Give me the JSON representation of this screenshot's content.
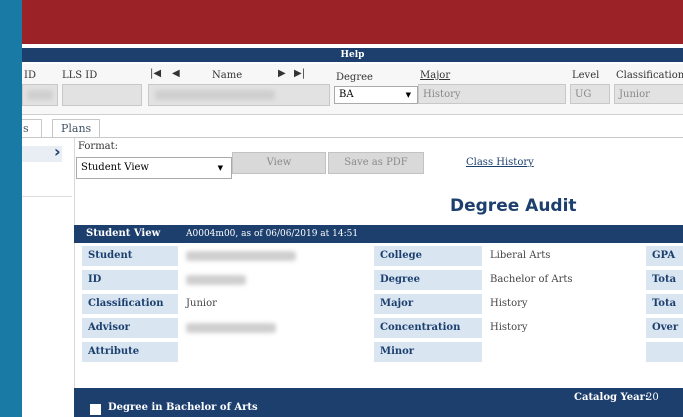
{
  "header": {
    "help_label": "Help"
  },
  "student_bar": {
    "id_label": "ID",
    "lls_id_label": "LLS ID",
    "name_label": "Name",
    "nav_first": "|◀",
    "nav_prev": "◀",
    "nav_next": "▶",
    "nav_last": "▶|",
    "degree_label": "Degree",
    "degree_value": "BA",
    "major_label": "Major",
    "major_value": "History",
    "level_label": "Level",
    "level_value": "UG",
    "classification_label": "Classification",
    "classification_value": "Junior"
  },
  "tabs": [
    {
      "label": "s"
    },
    {
      "label": "Plans"
    }
  ],
  "toolbar": {
    "format_label": "Format:",
    "format_value": "Student View",
    "view_label": "View",
    "save_pdf_label": "Save as PDF",
    "class_history_label": "Class History"
  },
  "audit": {
    "title": "Degree Audit",
    "student_view_label": "Student View",
    "student_view_meta": "A0004m00, as of 06/06/2019 at 14:51",
    "rows": [
      {
        "k1": "Student",
        "v1": "",
        "k2": "College",
        "v2": "Liberal Arts",
        "k3": "GPA"
      },
      {
        "k1": "ID",
        "v1": "",
        "k2": "Degree",
        "v2": "Bachelor of Arts",
        "k3": "Tota"
      },
      {
        "k1": "Classification",
        "v1": "Junior",
        "k2": "Major",
        "v2": "History",
        "k3": "Tota"
      },
      {
        "k1": "Advisor",
        "v1": "",
        "k2": "Concentration",
        "v2": "History",
        "k3": "Over"
      },
      {
        "k1": "Attribute",
        "v1": "",
        "k2": "Minor",
        "v2": "",
        "k3": ""
      }
    ],
    "section_label": "Degree in Bachelor of Arts",
    "catalog_year_label": "Catalog Year:",
    "catalog_year_value": "20"
  },
  "colors": {
    "brand_red": "#9b2328",
    "navy": "#1c3f6e",
    "key_cell": "#d9e6f2",
    "edge_blue": "#1a7aa6"
  }
}
